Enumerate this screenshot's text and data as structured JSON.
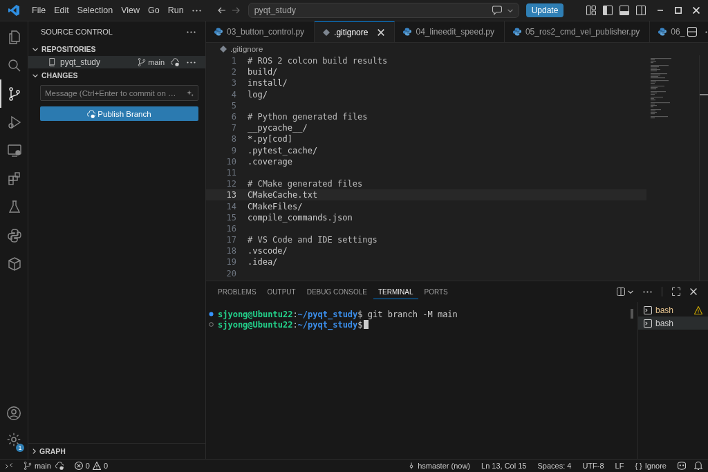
{
  "menu": [
    "File",
    "Edit",
    "Selection",
    "View",
    "Go",
    "Run"
  ],
  "search": {
    "value": "pyqt_study"
  },
  "update_button": "Update",
  "activity_bar": {
    "items": [
      {
        "kind": "explorer",
        "selected": false
      },
      {
        "kind": "search",
        "selected": false
      },
      {
        "kind": "scm",
        "selected": true
      },
      {
        "kind": "debug",
        "selected": false
      },
      {
        "kind": "remote",
        "selected": false
      },
      {
        "kind": "extensions",
        "selected": false
      },
      {
        "kind": "testing",
        "selected": false
      },
      {
        "kind": "python",
        "selected": false
      },
      {
        "kind": "containers",
        "selected": false
      }
    ],
    "settings_badge": "1"
  },
  "sidebar": {
    "title": "SOURCE CONTROL",
    "repositories_header": "REPOSITORIES",
    "repository": {
      "name": "pyqt_study",
      "branch": "main"
    },
    "changes_header": "CHANGES",
    "message": {
      "placeholder": "Message (Ctrl+Enter to commit on …"
    },
    "publish_button": "Publish Branch",
    "graph_header": "GRAPH"
  },
  "tabs": [
    {
      "label": "03_button_control.py",
      "kind": "python",
      "selected": false
    },
    {
      "label": ".gitignore",
      "kind": "gitignore",
      "selected": true
    },
    {
      "label": "04_lineedit_speed.py",
      "kind": "python",
      "selected": false
    },
    {
      "label": "05_ros2_cmd_vel_publisher.py",
      "kind": "python",
      "selected": false
    },
    {
      "label": "06_",
      "kind": "python",
      "selected": false
    }
  ],
  "breadcrumb": ".gitignore",
  "code": [
    {
      "number": "1",
      "text": "# ROS 2 colcon build results",
      "kind": "comment",
      "current": false
    },
    {
      "number": "2",
      "text": "build/",
      "kind": "plain",
      "current": false
    },
    {
      "number": "3",
      "text": "install/",
      "kind": "plain",
      "current": false
    },
    {
      "number": "4",
      "text": "log/",
      "kind": "plain",
      "current": false
    },
    {
      "number": "5",
      "current": false
    },
    {
      "number": "6",
      "text": "# Python generated files",
      "kind": "comment",
      "current": false
    },
    {
      "number": "7",
      "text": "__pycache__/",
      "kind": "plain",
      "current": false
    },
    {
      "number": "8",
      "text": "*.py[cod]",
      "kind": "plain",
      "current": false
    },
    {
      "number": "9",
      "text": ".pytest_cache/",
      "kind": "plain",
      "current": false
    },
    {
      "number": "10",
      "text": ".coverage",
      "kind": "plain",
      "current": false
    },
    {
      "number": "11",
      "current": false
    },
    {
      "number": "12",
      "text": "# CMake generated files",
      "kind": "comment",
      "current": false
    },
    {
      "number": "13",
      "text": "CMakeCache.txt",
      "kind": "plain",
      "current": true
    },
    {
      "number": "14",
      "text": "CMakeFiles/",
      "kind": "plain",
      "current": false
    },
    {
      "number": "15",
      "text": "compile_commands.json",
      "kind": "plain",
      "current": false
    },
    {
      "number": "16",
      "current": false
    },
    {
      "number": "17",
      "text": "# VS Code and IDE settings",
      "kind": "comment",
      "current": false
    },
    {
      "number": "18",
      "text": ".vscode/",
      "kind": "plain",
      "current": false
    },
    {
      "number": "19",
      "text": ".idea/",
      "kind": "plain",
      "current": false
    },
    {
      "number": "20",
      "current": false
    }
  ],
  "panel_tabs": [
    {
      "label": "PROBLEMS",
      "selected": false
    },
    {
      "label": "OUTPUT",
      "selected": false
    },
    {
      "label": "DEBUG CONSOLE",
      "selected": false
    },
    {
      "label": "TERMINAL",
      "selected": true
    },
    {
      "label": "PORTS",
      "selected": false
    }
  ],
  "terminal": [
    {
      "finished": true,
      "user": "sjyong@Ubuntu22",
      "sep": ":",
      "path": "~/pyqt_study",
      "end": "$",
      "command": " git branch -M main",
      "cursor": false
    },
    {
      "finished": false,
      "user": "sjyong@Ubuntu22",
      "sep": ":",
      "path": "~/pyqt_study",
      "end": "$",
      "cursor": true
    }
  ],
  "terminal_instances": [
    {
      "label": "bash",
      "warning": true,
      "selected": false
    },
    {
      "label": "bash",
      "warning": false,
      "selected": true
    }
  ],
  "status_bar": {
    "branch": "main",
    "errors": "0",
    "warnings": "0",
    "right": [
      "hsmaster (now)",
      "Ln 13, Col 15",
      "Spaces: 4",
      "UTF-8",
      "LF"
    ],
    "language_icon": "{ }",
    "language": "Ignore"
  }
}
